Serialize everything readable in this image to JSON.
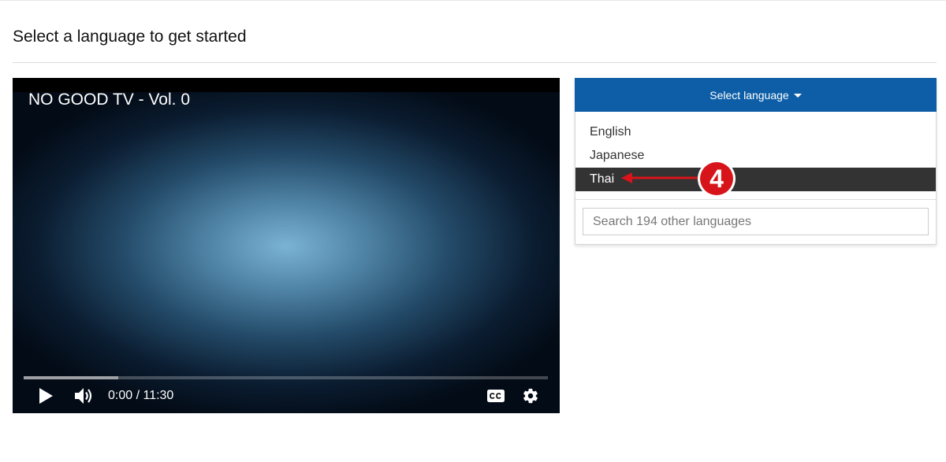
{
  "page": {
    "title": "Select a language to get started"
  },
  "video": {
    "title": "NO GOOD TV - Vol. 0",
    "current_time": "0:00",
    "duration": "11:30",
    "time_display": "0:00 / 11:30",
    "progress_buffered_fraction": 0.18,
    "icons": {
      "play": "play-icon",
      "volume": "volume-icon",
      "captions": "closed-captions-icon",
      "settings": "gear-icon"
    }
  },
  "language_panel": {
    "select_label": "Select language",
    "options": [
      {
        "label": "English",
        "selected": false
      },
      {
        "label": "Japanese",
        "selected": false
      },
      {
        "label": "Thai",
        "selected": true
      }
    ],
    "search_placeholder": "Search 194 other languages",
    "search_value": ""
  },
  "annotation": {
    "step_number": "4"
  },
  "colors": {
    "accent_blue": "#0d5ea6",
    "selected_row": "#333333",
    "annotation_red": "#d7141a"
  }
}
